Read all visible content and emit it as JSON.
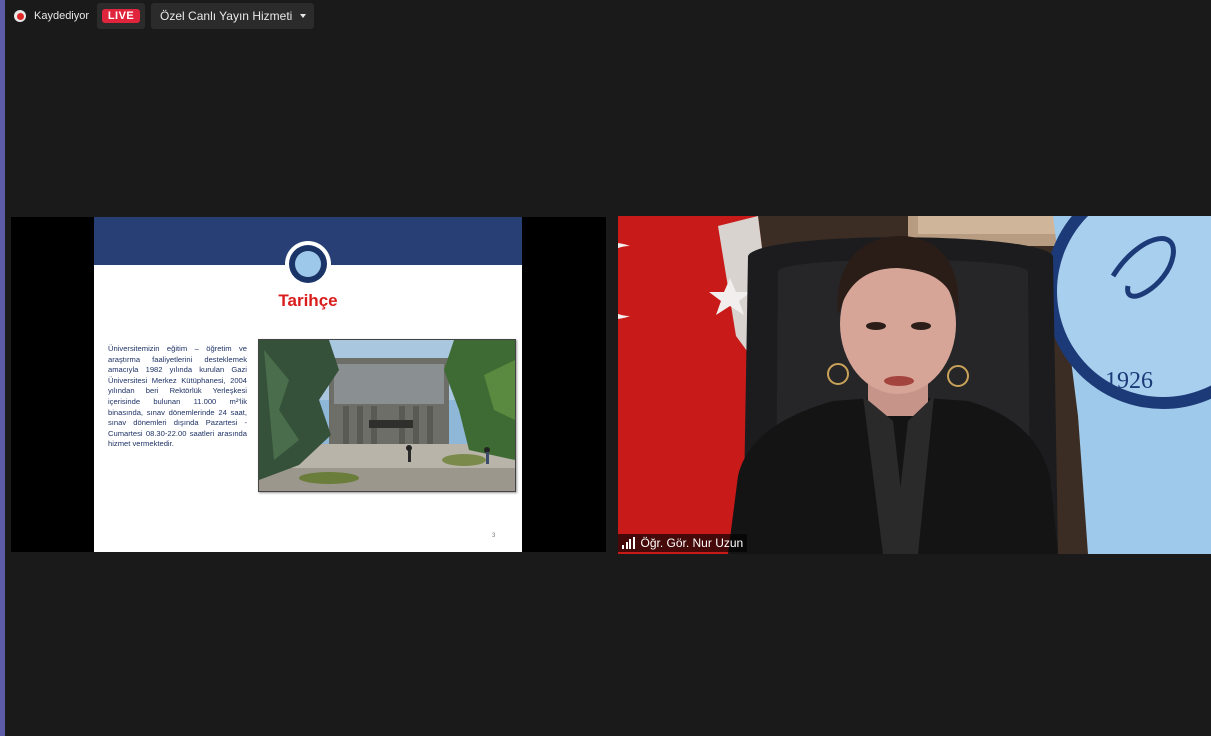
{
  "recording": {
    "label": "Kaydediyor"
  },
  "live": {
    "badge": "LIVE"
  },
  "stream_service": {
    "label": "Özel Canlı Yayın Hizmeti"
  },
  "slide": {
    "title": "Tarihçe",
    "body_text": "Üniversitemizin eğitim – öğretim ve araştırma faaliyetlerini desteklemek amacıyla 1982 yılında kurulan Gazi Üniversitesi Merkez Kütüphanesi, 2004 yılından beri Rektörlük Yerleşkesi içerisinde bulunan 11.000 m²'lik binasında, sınav dönemlerinde 24 saat, sınav dönemleri dışında Pazartesi - Cumartesi 08.30-22.00 saatleri arasında hizmet vermektedir.",
    "page_number": "3"
  },
  "participant": {
    "name": "Öğr. Gör. Nur Uzun"
  },
  "colors": {
    "live": "#e0243c",
    "slide_header": "#283f75",
    "slide_title": "#d91c1c",
    "background": "#1a1a1a"
  }
}
